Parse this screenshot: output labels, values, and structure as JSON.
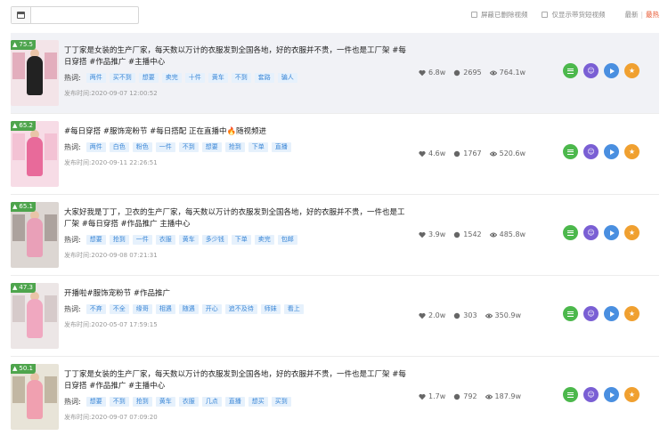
{
  "toolbar": {
    "filter_deleted": "屏蔽已删除视频",
    "filter_goods": "仅显示带货短视频",
    "sort_latest": "最新",
    "sort_sep": "|",
    "sort_hot": "最热"
  },
  "tags_label": "热词:",
  "time_label": "发布时间:",
  "colors": {
    "green": "#4cb84c",
    "purple": "#7a5fd4",
    "blue": "#4a8fe0",
    "orange": "#f0a030",
    "tag_bg": "#e6f1fc",
    "tag_text": "#3a86d6"
  },
  "icons": {
    "likes": "heart-icon",
    "comments": "comment-icon",
    "views": "eye-icon",
    "a1": "list-icon",
    "a2": "users-icon",
    "a3": "play-icon",
    "a4": "star-icon"
  },
  "rows": [
    {
      "score": "75.5",
      "desc": "丁丁家是女装的生产厂家，每天数以万计的衣服发到全国各地，好的衣服并不贵，一件也是工厂架 #每日穿搭 #作品推广 #主播中心",
      "tags": [
        "两件",
        "买不到",
        "想要",
        "卖完",
        "十件",
        "黄车",
        "不到",
        "套路",
        "骗人"
      ],
      "time": "2020-09-07 12:00:52",
      "likes": "6.8w",
      "comments": "2695",
      "views": "764.1w"
    },
    {
      "score": "65.2",
      "desc": "#每日穿搭 #服饰宠粉节 #每日搭配 正在直播中🔥随视频进",
      "tags": [
        "两件",
        "白色",
        "粉色",
        "一件",
        "不到",
        "想要",
        "抢到",
        "下单",
        "直播"
      ],
      "time": "2020-09-11 22:26:51",
      "likes": "4.6w",
      "comments": "1767",
      "views": "520.6w"
    },
    {
      "score": "65.1",
      "desc": "大家好我是丁丁，卫衣的生产厂家，每天数以万计的衣服发到全国各地，好的衣服并不贵，一件也是工厂架 #每日穿搭 #作品推广 主播中心",
      "tags": [
        "想要",
        "抢到",
        "一件",
        "衣服",
        "黄车",
        "多少钱",
        "下单",
        "卖完",
        "包邮"
      ],
      "time": "2020-09-08 07:21:31",
      "likes": "3.9w",
      "comments": "1542",
      "views": "485.8w"
    },
    {
      "score": "47.3",
      "desc": "开播啦#服饰宠粉节 #作品推广",
      "tags": [
        "不弃",
        "不全",
        "缘哥",
        "相遇",
        "随遇",
        "开心",
        "追不及待",
        "师妹",
        "看上"
      ],
      "time": "2020-05-07 17:59:15",
      "likes": "2.0w",
      "comments": "303",
      "views": "350.9w"
    },
    {
      "score": "50.1",
      "desc": "丁丁家是女装的生产厂家，每天数以万计的衣服发到全国各地，好的衣服并不贵，一件也是工厂架 #每日穿搭 #作品推广 #主播中心",
      "tags": [
        "想要",
        "不到",
        "抢到",
        "黄车",
        "衣服",
        "几点",
        "直播",
        "想买",
        "买到"
      ],
      "time": "2020-09-07 07:09:20",
      "likes": "1.7w",
      "comments": "792",
      "views": "187.9w"
    }
  ]
}
